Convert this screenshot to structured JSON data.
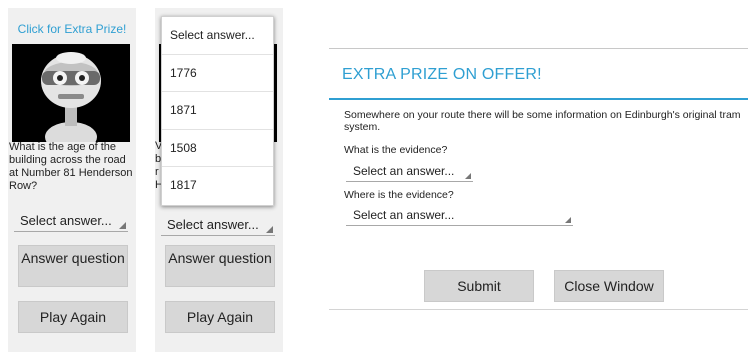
{
  "panel_a": {
    "prize_link": "Click for Extra Prize!",
    "question": "What is the age of the building across the road at Number 81 Henderson Row?",
    "spinner_value": "Select answer...",
    "answer_button": "Answer question",
    "play_again_button": "Play Again"
  },
  "panel_b": {
    "spinner_value": "Select answer...",
    "answer_button": "Answer question",
    "play_again_button": "Play Again",
    "dropdown_options": [
      "Select answer...",
      "1776",
      "1871",
      "1508",
      "1817"
    ],
    "question_sliver": [
      "V",
      "b",
      "r",
      "H"
    ]
  },
  "dialog": {
    "title": "EXTRA PRIZE ON OFFER!",
    "message": "Somewhere on your route there will be some information on Edinburgh's original tram system.",
    "evidence_what_label": "What is the evidence?",
    "evidence_what_value": "Select an answer...",
    "evidence_where_label": "Where is the evidence?",
    "evidence_where_value": "Select an answer...",
    "submit_button": "Submit",
    "close_button": "Close Window"
  },
  "colors": {
    "accent": "#2f9fd2",
    "button_bg": "#d7d7d7",
    "panel_bg": "#f0f0f0"
  }
}
